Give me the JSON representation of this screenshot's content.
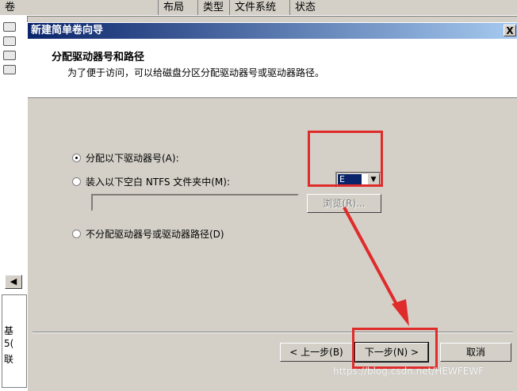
{
  "background": {
    "columns": [
      "卷",
      "布局",
      "类型",
      "文件系统",
      "状态"
    ],
    "lower_panel_text": [
      "基",
      "5(",
      "联"
    ]
  },
  "dialog": {
    "title": "新建简单卷向导",
    "close_label": "X",
    "header_title": "分配驱动器号和路径",
    "header_subtitle": "为了便于访问，可以给磁盘分区分配驱动器号或驱动器路径。",
    "options": {
      "assign_letter": "分配以下驱动器号(A):",
      "mount_folder": "装入以下空白 NTFS 文件夹中(M):",
      "no_assign": "不分配驱动器号或驱动器路径(D)"
    },
    "selected_option": "assign_letter",
    "drive_letter": "E",
    "folder_path_value": "",
    "browse_label": "浏览(R)...",
    "buttons": {
      "back": "< 上一步(B)",
      "next": "下一步(N) >",
      "cancel": "取消"
    }
  },
  "watermark": "https://blog.csdn.net/HEWFEWF",
  "colors": {
    "highlight": "#e02b2b",
    "titlebar": "#0a246a"
  }
}
